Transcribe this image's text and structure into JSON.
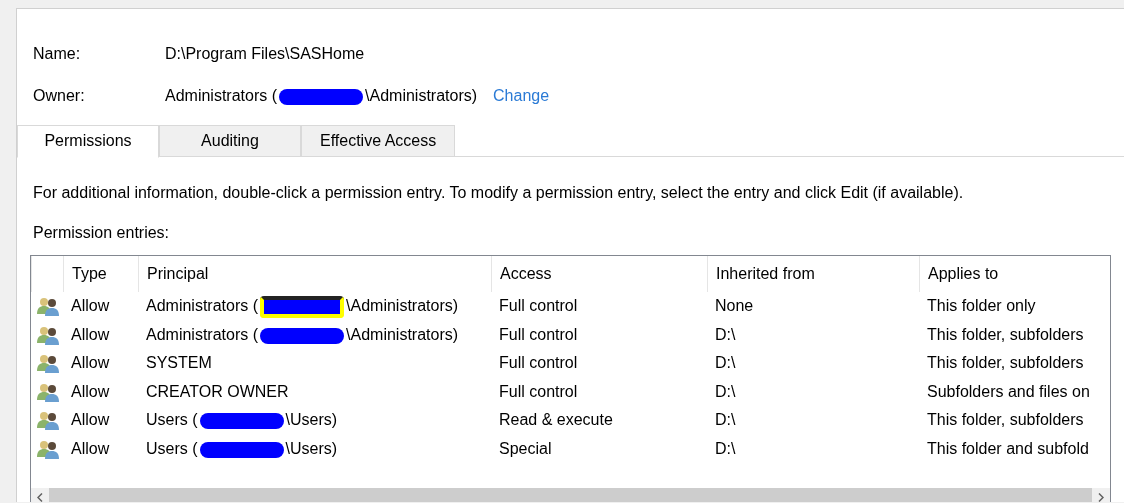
{
  "name": {
    "label": "Name:",
    "value": "D:\\Program Files\\SASHome"
  },
  "owner": {
    "label": "Owner:",
    "before": "Administrators (",
    "after": "\\Administrators)",
    "redacted": true,
    "highlighted": false,
    "link": "Change"
  },
  "tabs": [
    {
      "label": "Permissions",
      "selected": true
    },
    {
      "label": "Auditing",
      "selected": false
    },
    {
      "label": "Effective Access",
      "selected": false
    }
  ],
  "info": "For additional information, double-click a permission entry. To modify a permission entry, select the entry and click Edit (if available).",
  "entries_label": "Permission entries:",
  "table": {
    "columns": [
      "Type",
      "Principal",
      "Access",
      "Inherited from",
      "Applies to"
    ],
    "rows": [
      {
        "type": "Allow",
        "principal": {
          "before": "Administrators (",
          "after": "\\Administrators)",
          "redacted": true,
          "highlighted": true
        },
        "access": "Full control",
        "inherited_from": "None",
        "applies_to": "This folder only"
      },
      {
        "type": "Allow",
        "principal": {
          "before": "Administrators (",
          "after": "\\Administrators)",
          "redacted": true,
          "highlighted": false
        },
        "access": "Full control",
        "inherited_from": "D:\\",
        "applies_to": "This folder, subfolders"
      },
      {
        "type": "Allow",
        "principal": {
          "before": "SYSTEM"
        },
        "access": "Full control",
        "inherited_from": "D:\\",
        "applies_to": "This folder, subfolders"
      },
      {
        "type": "Allow",
        "principal": {
          "before": "CREATOR OWNER"
        },
        "access": "Full control",
        "inherited_from": "D:\\",
        "applies_to": "Subfolders and files on"
      },
      {
        "type": "Allow",
        "principal": {
          "before": "Users (",
          "after": "\\Users)",
          "redacted": true,
          "highlighted": false
        },
        "access": "Read & execute",
        "inherited_from": "D:\\",
        "applies_to": "This folder, subfolders"
      },
      {
        "type": "Allow",
        "principal": {
          "before": "Users (",
          "after": "\\Users)",
          "redacted": true,
          "highlighted": false
        },
        "access": "Special",
        "inherited_from": "D:\\",
        "applies_to": "This folder and subfold"
      }
    ]
  }
}
